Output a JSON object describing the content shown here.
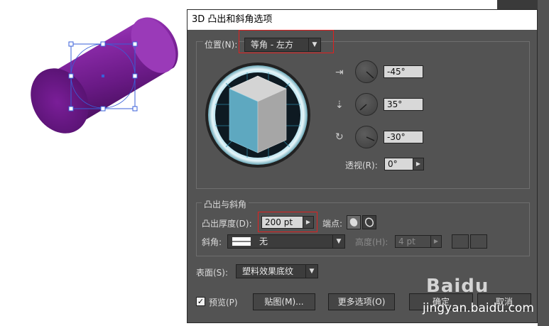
{
  "dialog": {
    "title": "3D 凸出和斜角选项",
    "position_label": "位置(N):",
    "position_value": "等角 - 左方",
    "rotation": [
      {
        "icon": "rotate-x-icon",
        "value": "-45°"
      },
      {
        "icon": "rotate-y-icon",
        "value": "35°"
      },
      {
        "icon": "rotate-z-icon",
        "value": "-30°"
      }
    ],
    "perspective_label": "透视(R):",
    "perspective_value": "0°",
    "extrude_section": "凸出与斜角",
    "extrude_depth_label": "凸出厚度(D):",
    "extrude_depth_value": "200 pt",
    "cap_label": "端点:",
    "bevel_label": "斜角:",
    "bevel_value": "无",
    "height_label": "高度(H):",
    "height_value": "4 pt",
    "surface_label": "表面(S):",
    "surface_value": "塑料效果底纹",
    "preview_label": "预览(P)",
    "preview_checked": true,
    "map_button": "贴图(M)...",
    "more_options_button": "更多选项(O)",
    "ok_button": "确定",
    "cancel_button": "取消"
  },
  "watermark": {
    "brand": "Baidu",
    "url": "jingyan.baidu.com"
  },
  "colors": {
    "dialog_bg": "#535353",
    "cylinder_purple": "#8b2fa8",
    "selection_blue": "#3a5fd8",
    "highlight_red": "#e02020"
  }
}
